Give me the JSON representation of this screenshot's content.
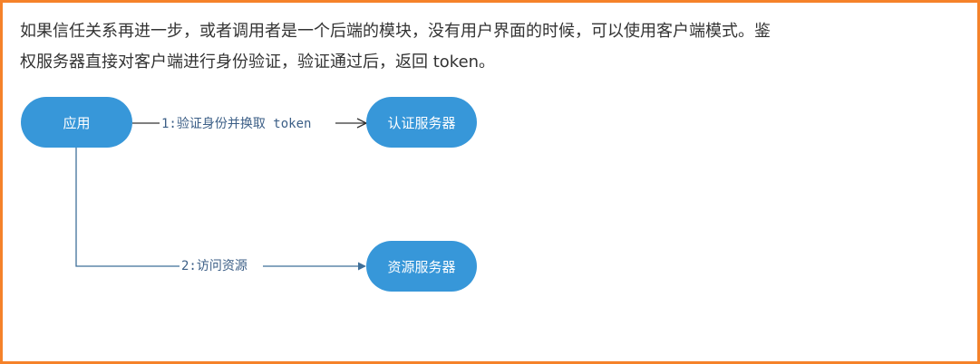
{
  "text": {
    "line1": "如果信任关系再进一步，或者调用者是一个后端的模块，没有用户界面的时候，可以使用客户端模式。鉴",
    "line2": "权服务器直接对客户端进行身份验证，验证通过后，返回 token。"
  },
  "diagram": {
    "nodes": {
      "app": "应用",
      "auth_server": "认证服务器",
      "resource_server": "资源服务器"
    },
    "edges": {
      "step1": "1:验证身份并换取 token",
      "step2": "2:访问资源"
    },
    "colors": {
      "node_fill": "#3797d9",
      "edge_stroke": "#3f6f99",
      "arrow_head": "#333333"
    }
  }
}
